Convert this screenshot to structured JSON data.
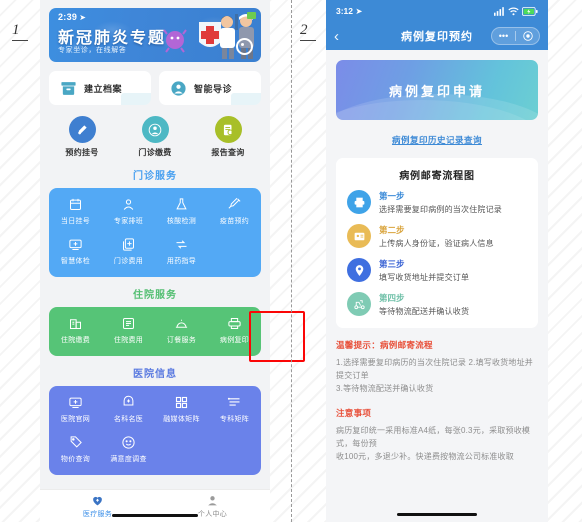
{
  "figure": {
    "markers": [
      "1",
      "2"
    ]
  },
  "screen1": {
    "banner": {
      "time": "2:39",
      "location_icon": "location-arrow-icon",
      "title": "新冠肺炎专题",
      "subtitle": "专家坐诊，在线解答"
    },
    "top_cards": [
      {
        "label": "建立档案",
        "icon": "file-box-icon"
      },
      {
        "label": "智能导诊",
        "icon": "user-circle-icon"
      }
    ],
    "quick_actions": [
      {
        "label": "预约挂号",
        "icon": "appointment-icon",
        "color": "#3f7fd0"
      },
      {
        "label": "门诊缴费",
        "icon": "payment-icon",
        "color": "#4db8c4"
      },
      {
        "label": "报告查询",
        "icon": "report-search-icon",
        "color": "#a8bf28"
      }
    ],
    "sections": [
      {
        "title": "门诊服务",
        "title_color": "#49a0f0",
        "panel_color": "#53a9f5",
        "items": [
          {
            "label": "当日挂号",
            "icon": "calendar-icon"
          },
          {
            "label": "专家排班",
            "icon": "doctor-icon"
          },
          {
            "label": "核酸检测",
            "icon": "flask-icon"
          },
          {
            "label": "疫苗预约",
            "icon": "syringe-icon"
          },
          {
            "label": "智慧体检",
            "icon": "monitor-plus-icon"
          },
          {
            "label": "门诊费用",
            "icon": "documents-plus-icon"
          },
          {
            "label": "用药指导",
            "icon": "pill-exchange-icon"
          }
        ]
      },
      {
        "title": "住院服务",
        "title_color": "#54bf72",
        "panel_color": "#56c477",
        "items": [
          {
            "label": "住院缴费",
            "icon": "hospital-building-icon"
          },
          {
            "label": "住院费用",
            "icon": "list-document-icon"
          },
          {
            "label": "订餐服务",
            "icon": "food-cover-icon"
          },
          {
            "label": "病例复印",
            "icon": "printer-icon",
            "highlighted": true
          }
        ]
      },
      {
        "title": "医院信息",
        "title_color": "#5a7ae0",
        "panel_color": "#6a82ea",
        "items": [
          {
            "label": "医院官网",
            "icon": "monitor-plus-icon"
          },
          {
            "label": "名科名医",
            "icon": "nurse-cap-icon"
          },
          {
            "label": "融媒体矩阵",
            "icon": "grid-squares-icon"
          },
          {
            "label": "专科矩阵",
            "icon": "list-lines-icon"
          },
          {
            "label": "物价查询",
            "icon": "price-tag-icon"
          },
          {
            "label": "满意度调查",
            "icon": "smiley-face-icon"
          }
        ]
      }
    ],
    "tabbar": [
      {
        "label": "医疗服务",
        "icon": "heart-plus-icon",
        "active": true
      },
      {
        "label": "个人中心",
        "icon": "person-icon",
        "active": false
      }
    ]
  },
  "screen2": {
    "status": {
      "time": "3:12",
      "location_icon": "location-arrow-icon",
      "signal_icon": "signal-bars-icon",
      "wifi_icon": "wifi-icon",
      "battery_icon": "battery-charging-icon"
    },
    "nav": {
      "back_icon": "chevron-left-icon",
      "title": "病例复印预约",
      "more_icon": "ellipsis-icon",
      "target_icon": "target-circle-icon"
    },
    "hero": {
      "title": "病例复印申请"
    },
    "history_link": "病例复印历史记录查询",
    "flow_card": {
      "title": "病例邮寄流程图",
      "steps": [
        {
          "name": "第一步",
          "desc": "选择需要复印病例的当次住院记录",
          "icon": "printer-icon",
          "color": "#3fa3e8",
          "name_color": "#3a8ad8"
        },
        {
          "name": "第二步",
          "desc": "上传病人身份证，验证病人信息",
          "icon": "id-card-icon",
          "color": "#e9bb56",
          "name_color": "#d9a43c"
        },
        {
          "name": "第三步",
          "desc": "填写收货地址并提交订单",
          "icon": "location-pin-icon",
          "color": "#3f6fe0",
          "name_color": "#3a63d4"
        },
        {
          "name": "第四步",
          "desc": "等待物流配送并确认收货",
          "icon": "delivery-scooter-icon",
          "color": "#7fcbb4",
          "name_color": "#6fc0a8"
        }
      ]
    },
    "warn": {
      "title": "温馨提示：病例邮寄流程",
      "lines": [
        "1.选择需要复印病历的当次住院记录  2.填写收货地址并提交订单",
        "3.等待物流配送并确认收货"
      ]
    },
    "note": {
      "title": "注意事项",
      "lines": [
        "病历复印统一采用标准A4纸，每张0.3元，采取预收模式，每份预",
        "收100元，多退少补。快递费按物流公司标准收取"
      ]
    }
  }
}
